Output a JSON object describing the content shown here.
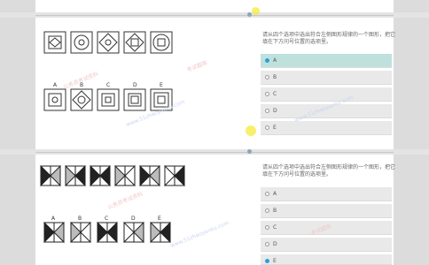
{
  "questions": [
    {
      "prompt": "请从四个选项中选出符合左侧图形规律的一个图形，把它填在下方问号位置的选项里。",
      "options": [
        {
          "label": "A",
          "selected": true
        },
        {
          "label": "B",
          "selected": false
        },
        {
          "label": "C",
          "selected": false
        },
        {
          "label": "D",
          "selected": false
        },
        {
          "label": "E",
          "selected": false
        }
      ],
      "answer_letters": [
        "A",
        "B",
        "C",
        "D",
        "E"
      ]
    },
    {
      "prompt": "请从四个选项中选出符合左侧图形规律的一个图形，把它填在下方问号位置的选项里。",
      "options": [
        {
          "label": "A",
          "selected": false
        },
        {
          "label": "B",
          "selected": false
        },
        {
          "label": "C",
          "selected": false
        },
        {
          "label": "D",
          "selected": false
        },
        {
          "label": "E",
          "selected": true
        }
      ],
      "answer_letters": [
        "A",
        "B",
        "C",
        "D",
        "E"
      ]
    }
  ],
  "watermarks": [
    "www.51zhaoyanku.com",
    "公务员考试资料",
    "考试题库"
  ],
  "colors": {
    "selected_bg": "#bfe1de",
    "radio_on": "#2f9ed6",
    "cursor": "#f5eb3c"
  }
}
